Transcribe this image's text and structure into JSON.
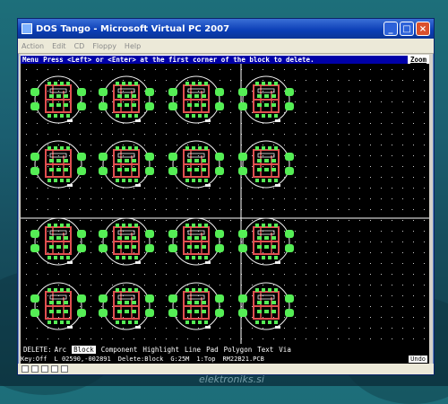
{
  "window": {
    "title": "DOS Tango - Microsoft Virtual PC 2007",
    "menu": [
      "Action",
      "Edit",
      "CD",
      "Floppy",
      "Help"
    ]
  },
  "dos": {
    "menu_key": "Menu",
    "prompt": "Press <Left> or <Enter> at the first corner of the block to delete.",
    "zoom_key": "Zoom",
    "delete_label": "DELETE:",
    "delete_options": [
      "Arc",
      "Block",
      "Component",
      "Highlight",
      "Line",
      "Pad",
      "Polygon",
      "Text",
      "Via"
    ],
    "selected_option": "Block",
    "status": {
      "key": "Key:Off",
      "coords": "L 02590,-002891",
      "mode": "Delete:Block",
      "grid": "G:25M",
      "layer": "1:Top",
      "file": "RM22B21.PCB",
      "undo": "Undo"
    }
  },
  "colors": {
    "grid_dots": "#c8c8c8",
    "pad_green": "#55ee55",
    "track_red": "#e05050",
    "silk_white": "#f0f0f0",
    "divider": "#ffffff"
  },
  "pcb": {
    "board_count": 16,
    "icon": "circular-pcb-board"
  },
  "watermark": "elektroniks.si"
}
